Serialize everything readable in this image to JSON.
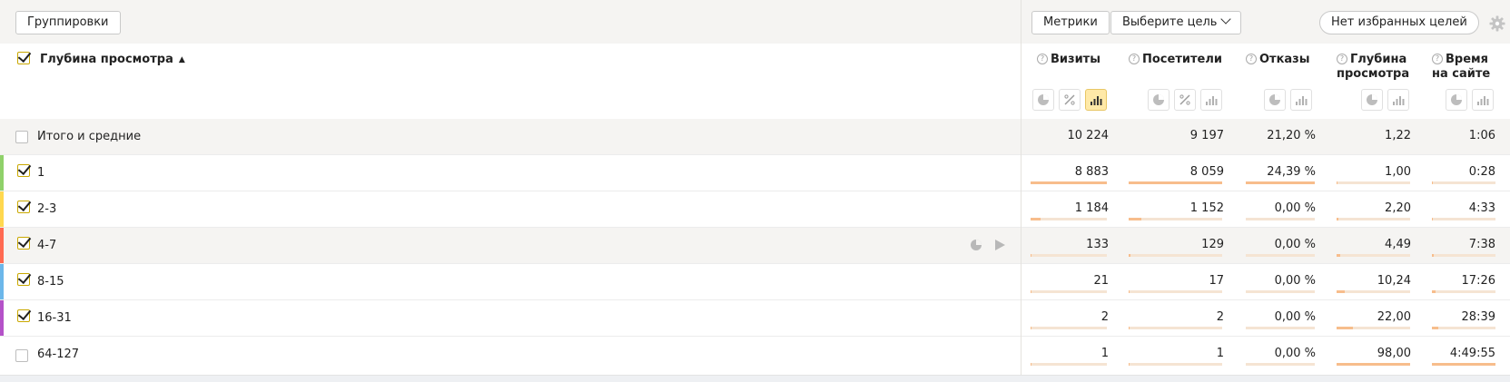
{
  "toolbar": {
    "groupings_label": "Группировки",
    "metrics_label": "Метрики",
    "goal_select_label": "Выберите цель",
    "favorites_label": "Нет избранных целей"
  },
  "header": {
    "dimension_title": "Глубина просмотра",
    "sort_indicator": "▲",
    "metrics": [
      {
        "line1": "Визиты",
        "line2": ""
      },
      {
        "line1": "Посетители",
        "line2": ""
      },
      {
        "line1": "Отказы",
        "line2": ""
      },
      {
        "line1": "Глубина",
        "line2": "просмотра"
      },
      {
        "line1": "Время",
        "line2": "на сайте"
      }
    ]
  },
  "totals": {
    "label": "Итого и средние",
    "values": [
      "10 224",
      "9 197",
      "21,20 %",
      "1,22",
      "1:06"
    ]
  },
  "rows": [
    {
      "label": "1",
      "checked": true,
      "color": "#8fd16a",
      "values": [
        "8 883",
        "8 059",
        "24,39 %",
        "1,00",
        "0:28"
      ],
      "bars": [
        1.0,
        1.0,
        1.0,
        0.01,
        0.01
      ]
    },
    {
      "label": "2-3",
      "checked": true,
      "color": "#ffd84f",
      "values": [
        "1 184",
        "1 152",
        "0,00 %",
        "2,20",
        "4:33"
      ],
      "bars": [
        0.13,
        0.14,
        0,
        0.02,
        0.02
      ]
    },
    {
      "label": "4-7",
      "checked": true,
      "color": "#ff6a52",
      "values": [
        "133",
        "129",
        "0,00 %",
        "4,49",
        "7:38"
      ],
      "bars": [
        0.015,
        0.016,
        0,
        0.045,
        0.03
      ]
    },
    {
      "label": "8-15",
      "checked": true,
      "color": "#6cb7ea",
      "values": [
        "21",
        "17",
        "0,00 %",
        "10,24",
        "17:26"
      ],
      "bars": [
        0.003,
        0.002,
        0,
        0.105,
        0.06
      ]
    },
    {
      "label": "16-31",
      "checked": true,
      "color": "#b452c8",
      "values": [
        "2",
        "2",
        "0,00 %",
        "22,00",
        "28:39"
      ],
      "bars": [
        0.0003,
        0.0003,
        0,
        0.225,
        0.1
      ]
    },
    {
      "label": "64-127",
      "checked": false,
      "color": "",
      "values": [
        "1",
        "1",
        "0,00 %",
        "98,00",
        "4:49:55"
      ],
      "bars": [
        0.0001,
        0.0001,
        0,
        1.0,
        1.0
      ]
    }
  ],
  "colors": {
    "accent_bar": "#f7bd8c",
    "bar_bg": "#f5e4d3",
    "active_chart_button": "#ffe9a8"
  }
}
